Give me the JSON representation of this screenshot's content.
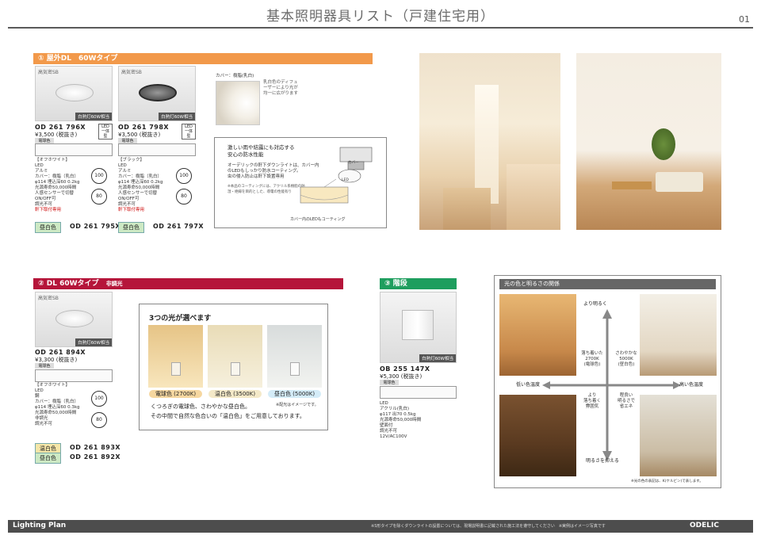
{
  "header": {
    "title": "基本照明器具リスト（戸建住宅用）",
    "page": "01"
  },
  "section1": {
    "title": "① 屋外DL　60Wタイプ",
    "color": "#f2994a",
    "products": [
      {
        "tag": "高気密SB",
        "foot": "白熱灯60W相当",
        "code": "OD 261 796X",
        "price": "¥3,500 (税抜き)",
        "variant_label": "昼白色",
        "variant_code": "OD 261 795X",
        "led": "LED一体型",
        "finish": "【オフホワイト】"
      },
      {
        "tag": "高気密SB",
        "foot": "白熱灯60W相当",
        "code": "OD 261 798X",
        "price": "¥3,500 (税抜き)",
        "variant_label": "昼白色",
        "variant_code": "OD 261 797X",
        "led": "LED一体型",
        "finish": "【ブラック】"
      }
    ],
    "cover_label": "カバー：樹脂(乳白)",
    "cover_note": "乳白色のディフューザーにより光が均一に広がります",
    "feature_title": "激しい雨や結露にも対応する\n安心の防水性能",
    "feature_text": "オーデリックの軒下ダウンライトは、カバー内のLEDもしっかり防水コーティング。\n虫の侵入防止は軒下設置専用",
    "feature_note": "※本品のコーティングには、アクリル系樹脂の防湿・絶縁を目的とした、導電の性能有り",
    "feature_caption": "カバー内のLEDもコーティング",
    "feature_parts": {
      "cover": "カバー",
      "led": "LED"
    },
    "specs": [
      "LED",
      "アルミ",
      "カバー：樹脂（乳白）",
      "φ114 埋込深60 0.2kg",
      "光源寿命50,000時間",
      "人感センサーで切替",
      "ON/OFF可",
      "調光不可"
    ],
    "warning": "軒下取付専用"
  },
  "section2": {
    "title": "② DL 60Wタイプ",
    "subtitle": "非調光",
    "color": "#b5153a",
    "product": {
      "tag": "高気密SB",
      "foot": "白熱灯60W相当",
      "code": "OD 261 894X",
      "price": "¥3,300 (税抜き)",
      "finish": "【オフホワイト】"
    },
    "variants": [
      {
        "label": "温白色",
        "code": "OD 261 893X",
        "bg": "#f5e6a8"
      },
      {
        "label": "昼白色",
        "code": "OD 261 892X",
        "bg": "#cde9c4"
      }
    ],
    "specs": [
      "LED",
      "鋼",
      "カバー：樹脂（乳白）",
      "φ114 埋込深60 0.3kg",
      "光源寿命50,000時間",
      "非調光",
      "調光不可"
    ],
    "three_lights": {
      "heading": "3つの光が選べます",
      "chips": [
        "電球色 (2700K)",
        "温白色 (3500K)",
        "昼白色 (5000K)"
      ],
      "text1": "くつろぎの電球色、さわやかな昼白色。",
      "text2": "その中間で自然な色合いの「温白色」をご用意しております。",
      "note": "※配光はイメージです。"
    }
  },
  "section3": {
    "title": "③ 階段",
    "color": "#1e9e5e",
    "product": {
      "foot": "白熱灯60W相当",
      "code": "OB 255 147X",
      "price": "¥5,300 (税抜き)",
      "variant_label": "電球色",
      "specs": [
        "LED",
        "アクリル(乳白)",
        "φ117 出70 0.5kg",
        "光源寿命50,000時間",
        "壁面付",
        "調光不可",
        "12V/AC100V"
      ]
    }
  },
  "color_relation": {
    "title": "光の色と明るさの関係",
    "top": "より明るく",
    "bottom": "明るさを抑える",
    "left": "低い色温度",
    "right": "高い色温度",
    "warm_label": "落ち着いた\n2700K\n(電球色)",
    "cool_label": "さわやかな\n5000K\n(昼白色)",
    "low_warm": "より\n落ち着く\n雰囲気",
    "low_cool": "程良い\n明るさで\n省エネ",
    "note": "※光の色の表記は、K(ケルビン)で表します。"
  },
  "footer": {
    "logo_left": "Lighting Plan",
    "note": "※S形タイプを除くダウンライトの設置については、現場説明書に記載された施工法を遵守してください　※実例はイメージ写真です",
    "logo_right": "ODELIC"
  }
}
